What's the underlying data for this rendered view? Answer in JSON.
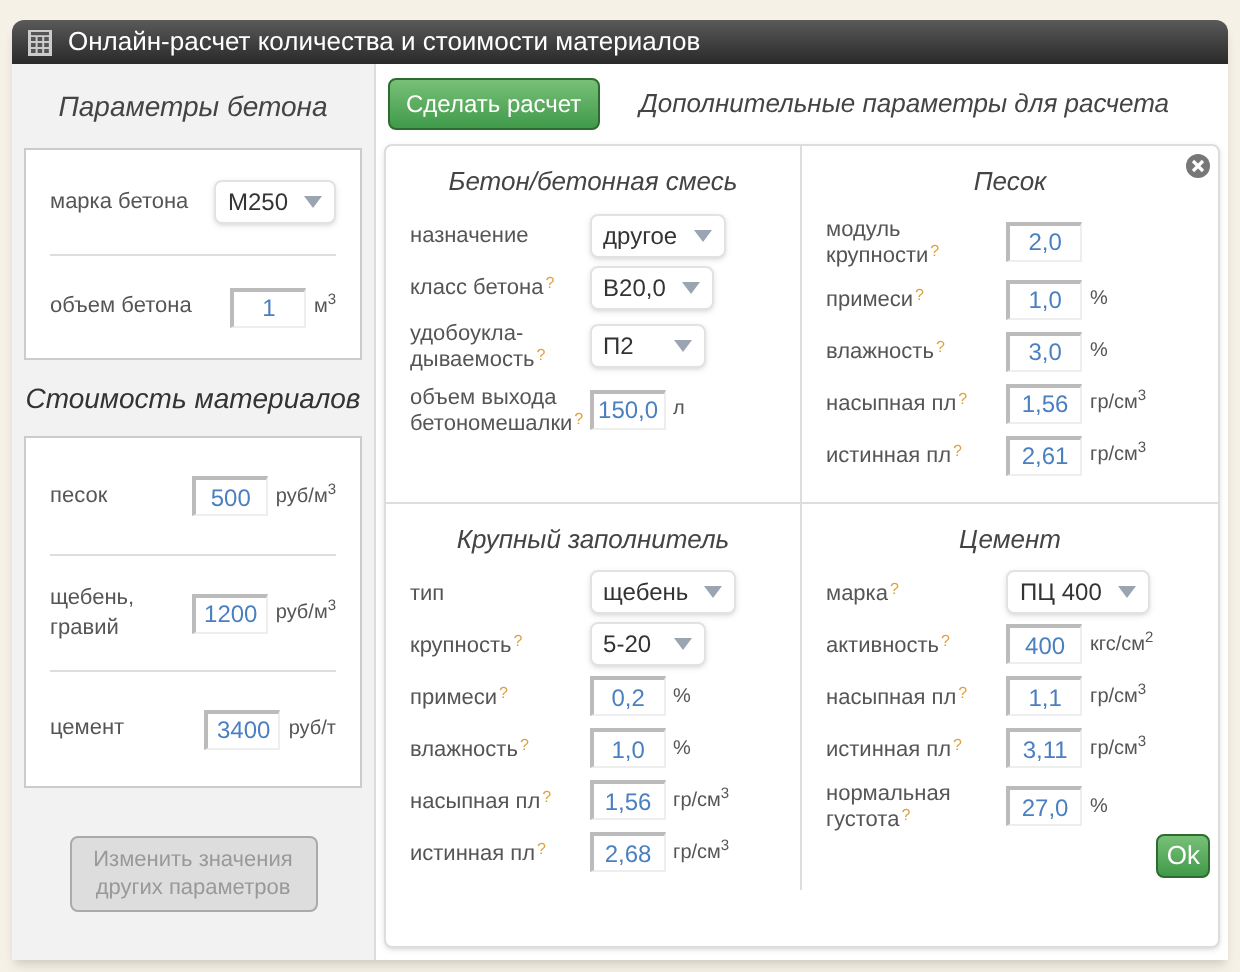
{
  "window": {
    "title": "Онлайн-расчет количества и стоимости материалов"
  },
  "concrete_params": {
    "title": "Параметры бетона",
    "rows": [
      {
        "label": "марка бетона",
        "kind": "select",
        "value": "М250"
      },
      {
        "label": "объем бетона",
        "kind": "input",
        "value": "1",
        "unit": "м$^{3}$"
      }
    ]
  },
  "material_costs": {
    "title": "Стоимость материалов",
    "rows": [
      {
        "label": "песок",
        "value": "500",
        "unit": "руб/м$^{3}$"
      },
      {
        "label": "щебень, гравий",
        "value": "1200",
        "unit": "руб/м$^{3}$"
      },
      {
        "label": "цемент",
        "value": "3400",
        "unit": "руб/т"
      }
    ]
  },
  "change_button": {
    "label": "Изменить значения других параметров",
    "disabled": true
  },
  "calculate_button": {
    "label": "Сделать расчет"
  },
  "extra_params_title": "Дополнительные параметры для расчета",
  "sections": [
    {
      "title": "Бетон/бетонная смесь",
      "rows": [
        {
          "label": "назначение",
          "kind": "select",
          "value": "другое"
        },
        {
          "label": "класс бетона",
          "hint": "?",
          "kind": "select",
          "value": "В20,0"
        },
        {
          "label": "удобоукла-дываемость",
          "hint": "?",
          "kind": "select",
          "value": "П2"
        },
        {
          "label": "объем выхода бетономешалки",
          "hint": "?",
          "kind": "input",
          "value": "150,0",
          "unit": "л"
        }
      ]
    },
    {
      "title": "Песок",
      "rows": [
        {
          "label": "модуль крупности",
          "hint": "?",
          "kind": "input",
          "value": "2,0"
        },
        {
          "label": "примеси",
          "hint": "?",
          "kind": "input",
          "value": "1,0",
          "unit": "%"
        },
        {
          "label": "влажность",
          "hint": "?",
          "kind": "input",
          "value": "3,0",
          "unit": "%"
        },
        {
          "label": "насыпная пл",
          "hint": "?",
          "kind": "input",
          "value": "1,56",
          "unit": "гр/см$^{3}$"
        },
        {
          "label": "истинная пл",
          "hint": "?",
          "kind": "input",
          "value": "2,61",
          "unit": "гр/см$^{3}$"
        }
      ]
    },
    {
      "title": "Крупный заполнитель",
      "rows": [
        {
          "label": "тип",
          "kind": "select",
          "value": "щебень"
        },
        {
          "label": "крупность",
          "hint": "?",
          "kind": "select",
          "value": "5-20"
        },
        {
          "label": "примеси",
          "hint": "?",
          "kind": "input",
          "value": "0,2",
          "unit": "%"
        },
        {
          "label": "влажность",
          "hint": "?",
          "kind": "input",
          "value": "1,0",
          "unit": "%"
        },
        {
          "label": "насыпная пл",
          "hint": "?",
          "kind": "input",
          "value": "1,56",
          "unit": "гр/см$^{3}$"
        },
        {
          "label": "истинная пл",
          "hint": "?",
          "kind": "input",
          "value": "2,68",
          "unit": "гр/см$^{3}$"
        }
      ]
    },
    {
      "title": "Цемент",
      "rows": [
        {
          "label": "марка",
          "hint": "?",
          "kind": "select",
          "value": "ПЦ 400"
        },
        {
          "label": "активность",
          "hint": "?",
          "kind": "input",
          "value": "400",
          "unit": "кгс/см$^{2}$"
        },
        {
          "label": "насыпная пл",
          "hint": "?",
          "kind": "input",
          "value": "1,1",
          "unit": "гр/см$^{3}$"
        },
        {
          "label": "истинная пл",
          "hint": "?",
          "kind": "input",
          "value": "3,11",
          "unit": "гр/см$^{3}$"
        },
        {
          "label": "нормальная густота",
          "hint": "?",
          "kind": "input",
          "value": "27,0",
          "unit": "%"
        }
      ]
    }
  ],
  "ok_button": {
    "label": "Ok"
  }
}
